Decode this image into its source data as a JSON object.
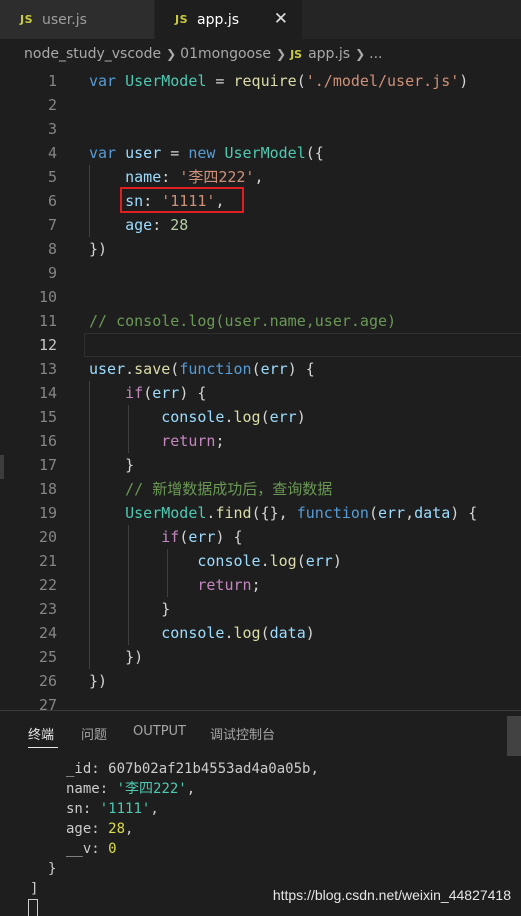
{
  "tabs": [
    {
      "badge": "JS",
      "label": "user.js"
    },
    {
      "badge": "JS",
      "label": "app.js",
      "close": "✕"
    }
  ],
  "breadcrumb": {
    "project": "node_study_vscode",
    "folder": "01mongoose",
    "file_badge": "JS",
    "file": "app.js",
    "more": "..."
  },
  "editor": {
    "line_numbers": [
      "1",
      "2",
      "3",
      "4",
      "5",
      "6",
      "7",
      "8",
      "9",
      "10",
      "11",
      "12",
      "13",
      "14",
      "15",
      "16",
      "17",
      "18",
      "19",
      "20",
      "21",
      "22",
      "23",
      "24",
      "25",
      "26",
      "27"
    ],
    "current_line": "12"
  },
  "panel": {
    "tabs": [
      "终端",
      "问题",
      "OUTPUT",
      "调试控制台"
    ],
    "terminal": {
      "id_key": "_id:",
      "id_value": "607b02af21b4553ad4a0a05b,",
      "name_key": "name:",
      "name_value": "'李四222'",
      "sn_key": "sn:",
      "sn_value": "'1111'",
      "age_key": "age:",
      "age_value": "28",
      "v_key": "__v:",
      "v_value": "0",
      "close_brace": "}",
      "close_bracket": "]"
    }
  },
  "watermark": "https://blog.csdn.net/weixin_44827418",
  "colors": {
    "keyword": "#569cd6",
    "variable": "#9cdcfe",
    "function": "#dcdcaa",
    "string": "#ce9178",
    "number": "#b5cea8",
    "comment": "#6a9955",
    "control": "#c586c0",
    "class": "#4ec9b0",
    "highlight_box": "#e02020"
  }
}
